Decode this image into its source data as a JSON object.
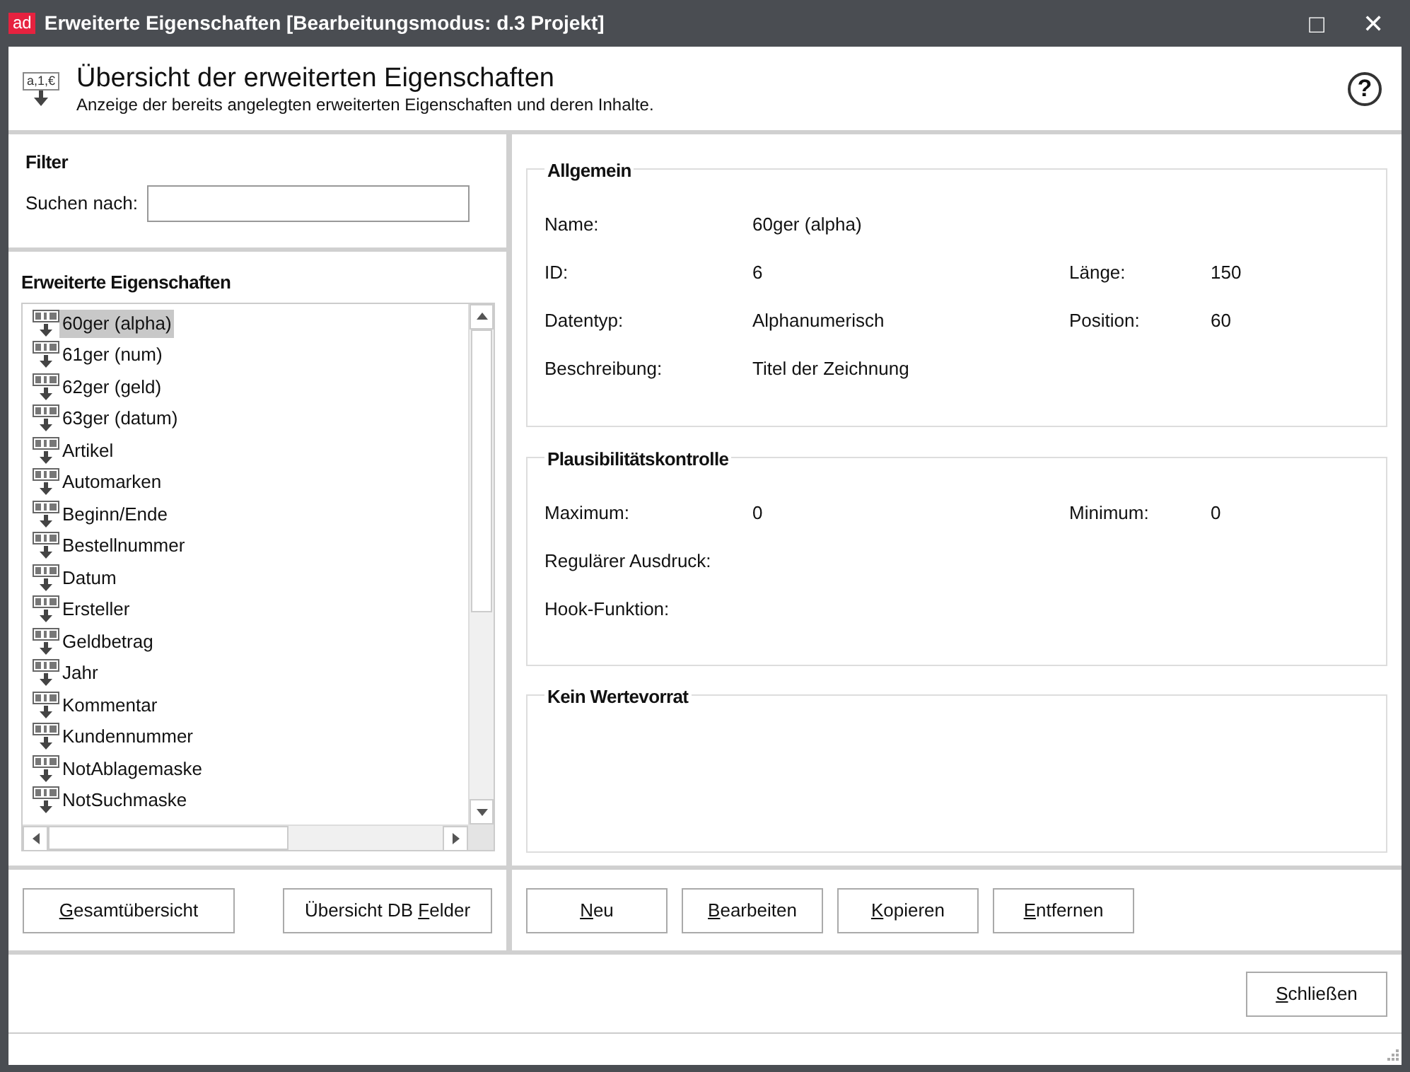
{
  "window": {
    "title": "Erweiterte Eigenschaften  [Bearbeitungsmodus: d.3 Projekt]",
    "app_badge": "ad",
    "controls": [
      "□",
      "✕"
    ]
  },
  "header": {
    "icon_text": "a,1,€",
    "title": "Übersicht der erweiterten Eigenschaften",
    "subtitle": "Anzeige der bereits angelegten erweiterten Eigenschaften und deren Inhalte.",
    "help": "?"
  },
  "filter": {
    "title": "Filter",
    "label": "Suchen nach:"
  },
  "properties": {
    "title": "Erweiterte Eigenschaften",
    "items": [
      {
        "label": "60ger (alpha)",
        "selected": true
      },
      {
        "label": "61ger (num)",
        "selected": false
      },
      {
        "label": "62ger (geld)",
        "selected": false
      },
      {
        "label": "63ger (datum)",
        "selected": false
      },
      {
        "label": "Artikel",
        "selected": false
      },
      {
        "label": "Automarken",
        "selected": false
      },
      {
        "label": "Beginn/Ende",
        "selected": false
      },
      {
        "label": "Bestellnummer",
        "selected": false
      },
      {
        "label": "Datum",
        "selected": false
      },
      {
        "label": "Ersteller",
        "selected": false
      },
      {
        "label": "Geldbetrag",
        "selected": false
      },
      {
        "label": "Jahr",
        "selected": false
      },
      {
        "label": "Kommentar",
        "selected": false
      },
      {
        "label": "Kundennummer",
        "selected": false
      },
      {
        "label": "NotAblagemaske",
        "selected": false
      },
      {
        "label": "NotSuchmaske",
        "selected": false
      }
    ]
  },
  "left_buttons": [
    {
      "key": "G",
      "rest": "esamtübersicht"
    },
    {
      "lead": "Übersicht DB ",
      "key": "F",
      "rest": "elder"
    }
  ],
  "general": {
    "title": "Allgemein",
    "rows": [
      [
        {
          "label": "Name:",
          "value": "60ger (alpha)"
        }
      ],
      [
        {
          "label": "ID:",
          "value": "6"
        },
        {
          "label": "Länge:",
          "value": "150"
        }
      ],
      [
        {
          "label": "Datentyp:",
          "value": "Alphanumerisch"
        },
        {
          "label": "Position:",
          "value": "60"
        }
      ],
      [
        {
          "label": "Beschreibung:",
          "value": "Titel der Zeichnung"
        }
      ]
    ]
  },
  "plausibility": {
    "title": "Plausibilitätskontrolle",
    "rows": [
      [
        {
          "label": "Maximum:",
          "value": "0"
        },
        {
          "label": "Minimum:",
          "value": "0"
        }
      ],
      [
        {
          "label": "Regulärer Ausdruck:"
        }
      ],
      [
        {
          "label": "Hook-Funktion:"
        }
      ]
    ]
  },
  "values": {
    "title": "Kein Wertevorrat"
  },
  "right_buttons": [
    {
      "key": "N",
      "rest": "eu"
    },
    {
      "key": "B",
      "rest": "earbeiten"
    },
    {
      "key": "K",
      "rest": "opieren"
    },
    {
      "key": "E",
      "rest": "ntfernen"
    }
  ],
  "footer_buttons": [
    {
      "key": "S",
      "rest": "chließen"
    }
  ]
}
